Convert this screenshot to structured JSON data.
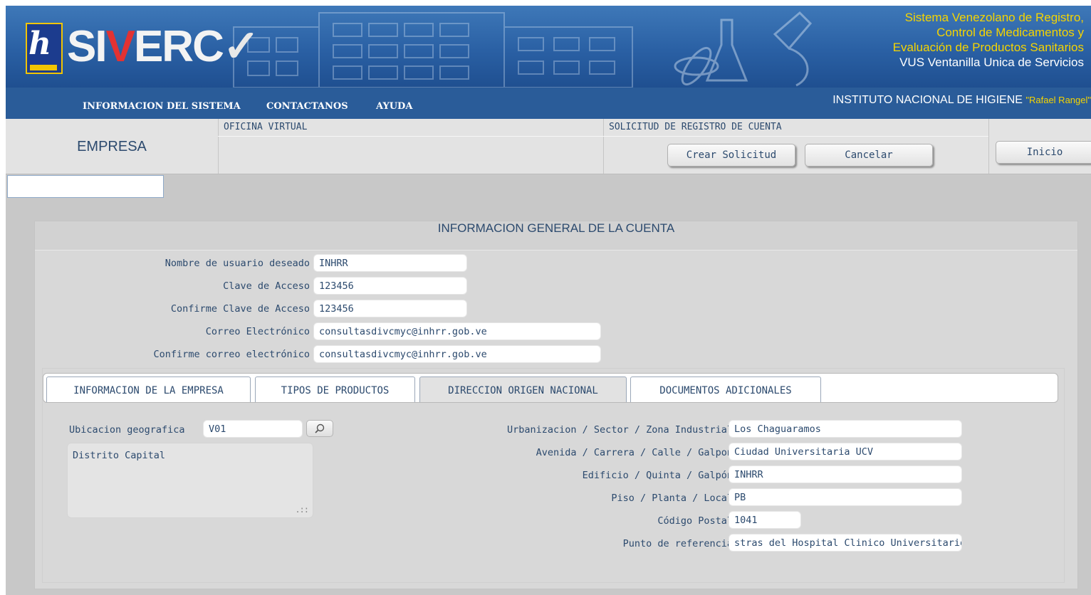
{
  "header": {
    "brand": "SIVERC",
    "logo_letter": "h",
    "subtitle_lines": [
      "Sistema Venezolano de Registro,",
      "Control de Medicamentos y",
      "Evaluación de Productos Sanitarios",
      "VUS Ventanilla Unica de Servicios"
    ],
    "colors": {
      "banner": "#2a60a4",
      "accent_yellow": "#f5d400",
      "brand_red": "#e23232"
    }
  },
  "nav": {
    "items": [
      "INFORMACION DEL SISTEMA",
      "CONTACTANOS",
      "AYUDA"
    ],
    "institute_name": "INSTITUTO NACIONAL DE HIGIENE",
    "institute_suffix": "\"Rafael Rangel\""
  },
  "toolbar": {
    "section_name": "EMPRESA",
    "oficina_caption": "OFICINA VIRTUAL",
    "solicitud_caption": "SOLICITUD DE REGISTRO DE CUENTA",
    "crear_label": "Crear Solicitud",
    "cancelar_label": "Cancelar",
    "inicio_label": "Inicio"
  },
  "account": {
    "title": "INFORMACION GENERAL DE LA CUENTA",
    "fields": [
      {
        "label": "Nombre de usuario deseado",
        "value": "INHRR"
      },
      {
        "label": "Clave de Acceso",
        "value": "123456"
      },
      {
        "label": "Confirme Clave de Acceso",
        "value": "123456"
      },
      {
        "label": "Correo Electrónico",
        "value": "consultasdivcmyc@inhrr.gob.ve"
      },
      {
        "label": "Confirme correo electrónico",
        "value": "consultasdivcmyc@inhrr.gob.ve"
      }
    ]
  },
  "tabs": {
    "items": [
      "INFORMACION DE LA EMPRESA",
      "TIPOS DE PRODUCTOS",
      "DIRECCION ORIGEN NACIONAL",
      "DOCUMENTOS ADICIONALES"
    ],
    "active": "DIRECCION ORIGEN NACIONAL"
  },
  "direccion": {
    "ubicacion_label": "Ubicacion geografica",
    "ubicacion_value": "V01",
    "ubicacion_text": "Distrito Capital",
    "fields": [
      {
        "label": "Urbanizacion / Sector / Zona Industrial",
        "value": "Los Chaguaramos"
      },
      {
        "label": "Avenida / Carrera / Calle / Galpon",
        "value": "Ciudad Universitaria UCV"
      },
      {
        "label": "Edificio / Quinta / Galpón",
        "value": "INHRR"
      },
      {
        "label": "Piso / Planta / Local",
        "value": "PB"
      },
      {
        "label": "Código Postal",
        "value": "1041"
      },
      {
        "label": "Punto de referencia",
        "value": "stras del Hospital Clinico Universitario"
      }
    ]
  }
}
